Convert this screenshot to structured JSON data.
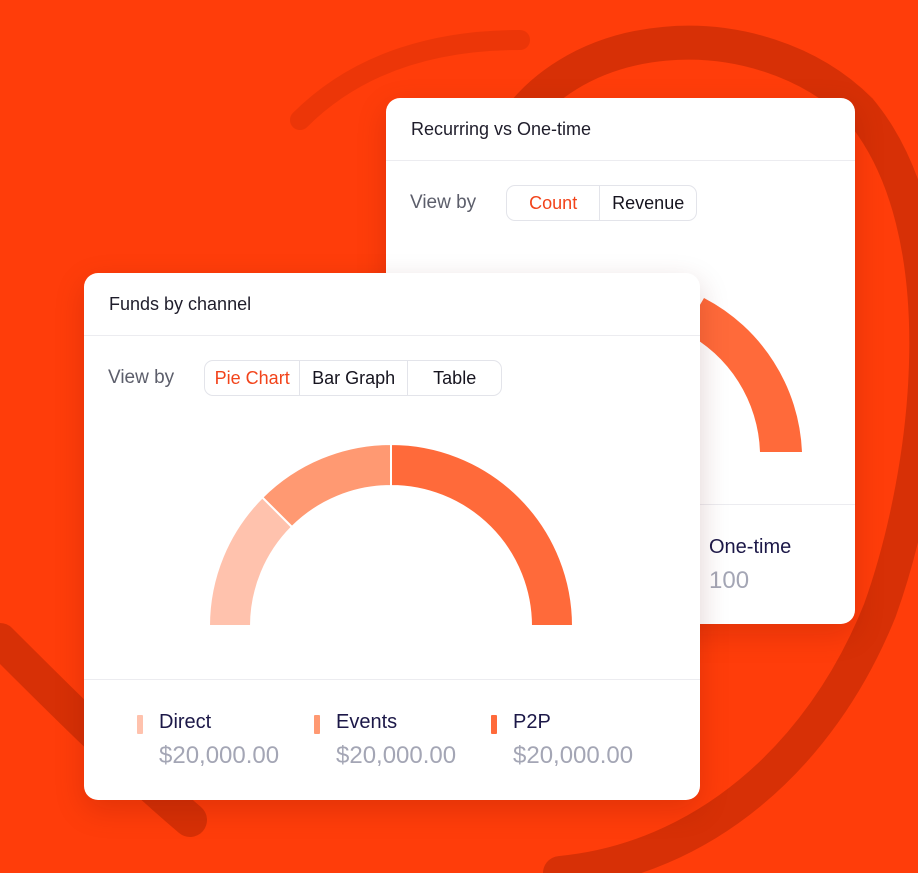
{
  "colors": {
    "background": "#ff3d0a",
    "accent": "#f2431a",
    "direct": "#ffc2ad",
    "events": "#ff9972",
    "p2p": "#ff6a3a"
  },
  "recurring_card": {
    "title": "Recurring vs One-time",
    "view_by_label": "View by",
    "segments": [
      {
        "label": "Count",
        "active": true
      },
      {
        "label": "Revenue",
        "active": false
      }
    ],
    "legend": [
      {
        "name": "One-time",
        "value": "100"
      }
    ]
  },
  "funds_card": {
    "title": "Funds by channel",
    "view_by_label": "View by",
    "segments": [
      {
        "label": "Pie Chart",
        "active": true
      },
      {
        "label": "Bar Graph",
        "active": false
      },
      {
        "label": "Table",
        "active": false
      }
    ],
    "legend": [
      {
        "name": "Direct",
        "value": "$20,000.00",
        "icon": "bar-swatch"
      },
      {
        "name": "Events",
        "value": "$20,000.00",
        "icon": "bar-swatch"
      },
      {
        "name": "P2P",
        "value": "$20,000.00",
        "icon": "bar-swatch"
      }
    ]
  },
  "chart_data": {
    "type": "pie",
    "variant": "half-donut",
    "categories": [
      "Direct",
      "Events",
      "P2P"
    ],
    "values": [
      20000,
      20000,
      40000
    ],
    "note_values": [
      "$20,000.00",
      "$20,000.00",
      "$20,000.00"
    ]
  }
}
